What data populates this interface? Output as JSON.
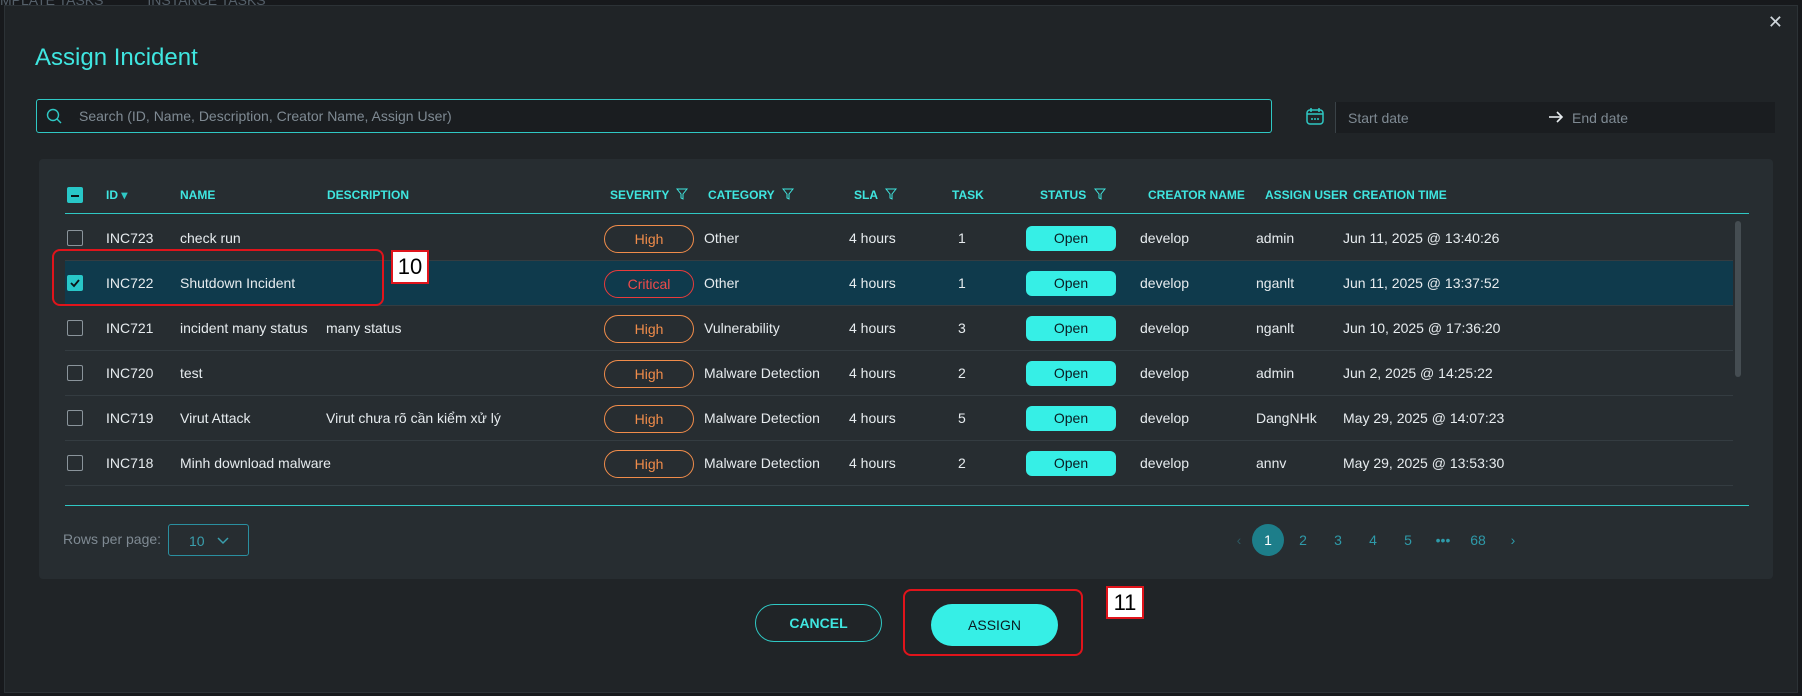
{
  "backdrop": {
    "tabs": [
      "MPLATE TASKS",
      "INSTANCE TASKS"
    ]
  },
  "modal": {
    "title": "Assign Incident",
    "close_glyph": "✕",
    "search": {
      "placeholder": "Search (ID, Name, Description, Creator Name, Assign User)",
      "value": ""
    },
    "date_range": {
      "start_placeholder": "Start date",
      "end_placeholder": "End date"
    }
  },
  "table": {
    "columns": {
      "id": "ID",
      "name": "NAME",
      "description": "DESCRIPTION",
      "severity": "SEVERITY",
      "category": "CATEGORY",
      "sla": "SLA",
      "task": "TASK",
      "status": "STATUS",
      "creator": "CREATOR NAME",
      "assign_user": "ASSIGN USER",
      "creation_time": "CREATION TIME"
    },
    "sort_indicator": "▾",
    "rows": [
      {
        "id": "INC723",
        "name": "check run",
        "description": "",
        "severity": "High",
        "category": "Other",
        "sla": "4 hours",
        "task": "1",
        "status": "Open",
        "creator": "develop",
        "assign_user": "admin",
        "creation_time": "Jun 11, 2025 @ 13:40:26",
        "selected": false
      },
      {
        "id": "INC722",
        "name": "Shutdown Incident",
        "description": "",
        "severity": "Critical",
        "category": "Other",
        "sla": "4 hours",
        "task": "1",
        "status": "Open",
        "creator": "develop",
        "assign_user": "nganlt",
        "creation_time": "Jun 11, 2025 @ 13:37:52",
        "selected": true
      },
      {
        "id": "INC721",
        "name": "incident many status",
        "description": "many status",
        "severity": "High",
        "category": "Vulnerability",
        "sla": "4 hours",
        "task": "3",
        "status": "Open",
        "creator": "develop",
        "assign_user": "nganlt",
        "creation_time": "Jun 10, 2025 @ 17:36:20",
        "selected": false
      },
      {
        "id": "INC720",
        "name": "test",
        "description": "",
        "severity": "High",
        "category": "Malware Detection",
        "sla": "4 hours",
        "task": "2",
        "status": "Open",
        "creator": "develop",
        "assign_user": "admin",
        "creation_time": "Jun 2, 2025 @ 14:25:22",
        "selected": false
      },
      {
        "id": "INC719",
        "name": "Virut Attack",
        "description": "Virut chưa rõ cần kiểm xử lý",
        "severity": "High",
        "category": "Malware Detection",
        "sla": "4 hours",
        "task": "5",
        "status": "Open",
        "creator": "develop",
        "assign_user": "DangNHk",
        "creation_time": "May 29, 2025 @ 14:07:23",
        "selected": false
      },
      {
        "id": "INC718",
        "name": "Minh download malware",
        "description": "",
        "severity": "High",
        "category": "Malware Detection",
        "sla": "4 hours",
        "task": "2",
        "status": "Open",
        "creator": "develop",
        "assign_user": "annv",
        "creation_time": "May 29, 2025 @ 13:53:30",
        "selected": false
      }
    ],
    "footer": {
      "rows_per_page_label": "Rows per page:",
      "rows_per_page_value": "10",
      "pages": [
        "1",
        "2",
        "3",
        "4",
        "5",
        "•••",
        "68"
      ],
      "active_page": "1",
      "prev_glyph": "‹",
      "next_glyph": "›"
    }
  },
  "actions": {
    "cancel_label": "CANCEL",
    "assign_label": "ASSIGN"
  },
  "annotations": {
    "marker_10": "10",
    "marker_11": "11"
  },
  "colors": {
    "accent": "#3fe6e0",
    "status_open": "#36efe6",
    "severity_high": "#f08c4a",
    "severity_critical": "#e83b3b",
    "annotation": "#e0141b",
    "selected_row": "#0f3a4c"
  },
  "icons": {
    "search": "search-icon",
    "calendar": "calendar-icon",
    "arrow": "arrow-right-icon",
    "filter": "filter-icon",
    "chevron": "chevron-down-icon",
    "close": "close-icon"
  }
}
